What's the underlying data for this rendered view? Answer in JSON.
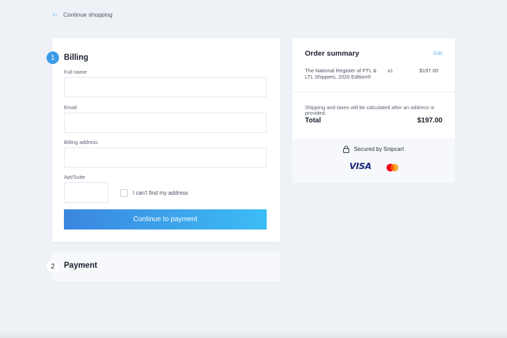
{
  "nav": {
    "back_icon": "arrow-left-icon",
    "back_label": "Continue shopping"
  },
  "billing": {
    "step_number": "1",
    "title": "Billing",
    "fields": [
      {
        "label": "Full name",
        "value": "",
        "placeholder": ""
      },
      {
        "label": "Email",
        "value": "",
        "placeholder": ""
      },
      {
        "label": "Billing address",
        "value": "",
        "placeholder": ""
      },
      {
        "label": "Apt/Suite",
        "value": "",
        "placeholder": ""
      }
    ],
    "checkbox_label": "I can't find my address",
    "checkbox_checked": false,
    "continue_label": "Continue to payment"
  },
  "payment": {
    "step_number": "2",
    "title": "Payment"
  },
  "summary": {
    "title": "Order summary",
    "edit_label": "Edit",
    "items": [
      {
        "name": "The National Register of FTL & LTL Shippers, 2020 Edition®",
        "qty": "x1",
        "price": "$197.00"
      }
    ],
    "shipping_note": "Shipping and taxes will be calculated after an address is provided.",
    "total_label": "Total",
    "total_value": "$197.00",
    "secured_label": "Secured by Snipcart",
    "lock_icon": "lock-icon",
    "payment_logos": [
      "VISA",
      "mastercard-logo"
    ]
  },
  "colors": {
    "background": "#eef1f5",
    "accent": "#3a9be8",
    "button_start": "#3b86e0",
    "button_end": "#3cbdf4",
    "visa": "#1a2a7c",
    "mastercard_red": "#eb001b",
    "mastercard_orange": "#f79e1b"
  }
}
